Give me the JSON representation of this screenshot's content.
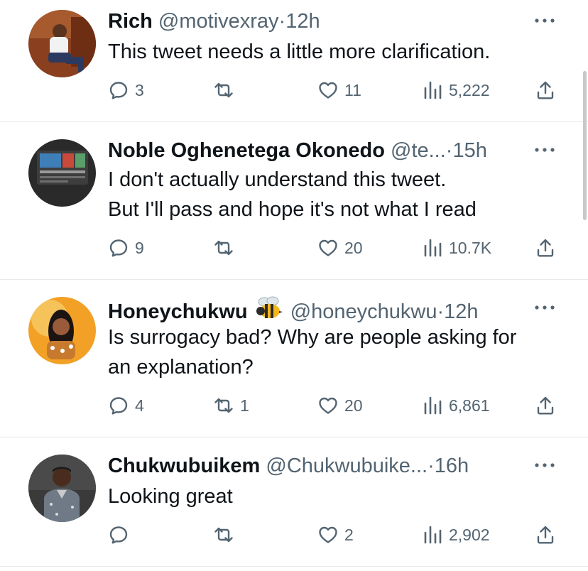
{
  "replies": [
    {
      "name": "Rich",
      "handle": "@motivexray",
      "time": "12h",
      "lines": [
        "This tweet needs a little more clarification."
      ],
      "reply_count": "3",
      "retweet_count": "",
      "like_count": "11",
      "view_count": "5,222"
    },
    {
      "name": "Noble Oghenetega Okonedo",
      "handle": "@te...",
      "time": "15h",
      "lines": [
        "I don't actually understand this tweet.",
        "But I'll pass and hope it's not what I read"
      ],
      "reply_count": "9",
      "retweet_count": "",
      "like_count": "20",
      "view_count": "10.7K"
    },
    {
      "name": "Honeychukwu",
      "name_emoji": "bee-emoji",
      "handle": "@honeychukwu",
      "time": "12h",
      "lines": [
        "Is surrogacy bad? Why are people asking for",
        "an explanation?"
      ],
      "reply_count": "4",
      "retweet_count": "1",
      "like_count": "20",
      "view_count": "6,861"
    },
    {
      "name": "Chukwubuikem",
      "handle": "@Chukwubuike...",
      "time": "16h",
      "lines": [
        "Looking great"
      ],
      "reply_count": "",
      "retweet_count": "",
      "like_count": "2",
      "view_count": "2,902"
    }
  ],
  "separator": "·",
  "icons": {
    "reply": "reply-icon",
    "retweet": "retweet-icon",
    "like": "heart-icon",
    "views": "views-chart-icon",
    "share": "share-icon",
    "more": "more-options-icon"
  },
  "colors": {
    "text": "#0f1419",
    "secondary": "#536471",
    "divider": "#e7e9ea"
  }
}
